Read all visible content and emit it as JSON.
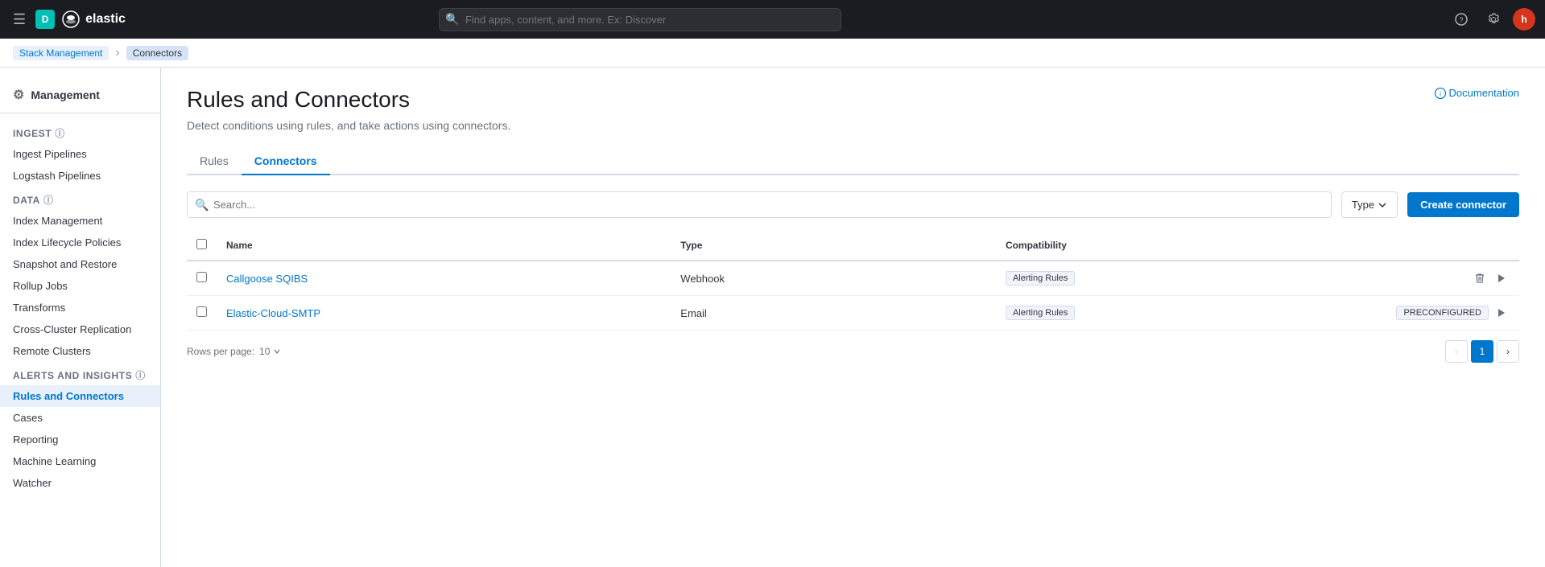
{
  "topnav": {
    "logo_text": "elastic",
    "hamburger_label": "☰",
    "d_badge": "D",
    "search_placeholder": "Find apps, content, and more. Ex: Discover",
    "user_avatar": "h"
  },
  "breadcrumb": {
    "parent_label": "Stack Management",
    "current_label": "Connectors"
  },
  "sidebar": {
    "management_label": "Management",
    "sections": [
      {
        "title": "Ingest",
        "items": [
          {
            "label": "Ingest Pipelines",
            "id": "ingest-pipelines"
          },
          {
            "label": "Logstash Pipelines",
            "id": "logstash-pipelines"
          }
        ]
      },
      {
        "title": "Data",
        "items": [
          {
            "label": "Index Management",
            "id": "index-management"
          },
          {
            "label": "Index Lifecycle Policies",
            "id": "ilm"
          },
          {
            "label": "Snapshot and Restore",
            "id": "snapshot"
          },
          {
            "label": "Rollup Jobs",
            "id": "rollup"
          },
          {
            "label": "Transforms",
            "id": "transforms"
          },
          {
            "label": "Cross-Cluster Replication",
            "id": "ccr"
          },
          {
            "label": "Remote Clusters",
            "id": "remote-clusters"
          }
        ]
      },
      {
        "title": "Alerts and Insights",
        "items": [
          {
            "label": "Rules and Connectors",
            "id": "rules-connectors",
            "active": true
          },
          {
            "label": "Cases",
            "id": "cases"
          },
          {
            "label": "Reporting",
            "id": "reporting"
          },
          {
            "label": "Machine Learning",
            "id": "ml"
          },
          {
            "label": "Watcher",
            "id": "watcher"
          }
        ]
      }
    ]
  },
  "page": {
    "title": "Rules and Connectors",
    "subtitle": "Detect conditions using rules, and take actions using connectors.",
    "doc_link": "Documentation",
    "tabs": [
      {
        "label": "Rules",
        "id": "rules",
        "active": false
      },
      {
        "label": "Connectors",
        "id": "connectors",
        "active": true
      }
    ],
    "search_placeholder": "Search...",
    "type_dropdown_label": "Type",
    "create_btn_label": "Create connector",
    "table": {
      "columns": [
        {
          "label": "Name"
        },
        {
          "label": "Type"
        },
        {
          "label": "Compatibility"
        },
        {
          "label": ""
        }
      ],
      "rows": [
        {
          "name": "Callgoose SQIBS",
          "type": "Webhook",
          "compatibility": "Alerting Rules",
          "preconfigured": false
        },
        {
          "name": "Elastic-Cloud-SMTP",
          "type": "Email",
          "compatibility": "Alerting Rules",
          "preconfigured": true
        }
      ]
    },
    "pagination": {
      "rows_per_page_label": "Rows per page:",
      "rows_per_page_value": "10",
      "current_page": "1"
    }
  }
}
